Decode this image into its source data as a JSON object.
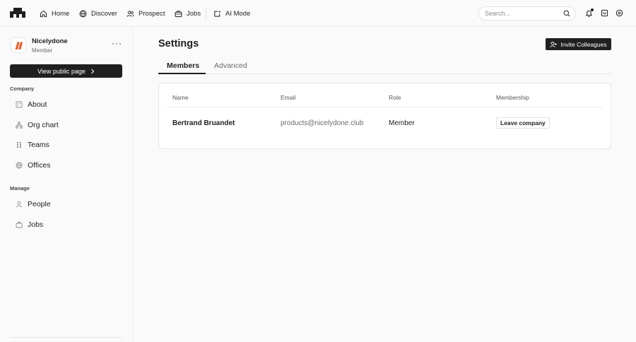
{
  "topnav": {
    "items": [
      {
        "label": "Home",
        "icon": "home-icon"
      },
      {
        "label": "Discover",
        "icon": "globe-icon"
      },
      {
        "label": "Prospect",
        "icon": "users-icon"
      },
      {
        "label": "Jobs",
        "icon": "briefcase-icon"
      },
      {
        "label": "AI Mode",
        "icon": "sparkle-icon"
      }
    ],
    "search_placeholder": "Search..."
  },
  "sidebar": {
    "org_name": "Nicelydone",
    "org_role": "Member",
    "view_public_label": "View public page",
    "company_label": "Company",
    "company_items": [
      {
        "label": "About",
        "icon": "building-icon"
      },
      {
        "label": "Org chart",
        "icon": "org-chart-icon"
      },
      {
        "label": "Teams",
        "icon": "teams-icon"
      },
      {
        "label": "Offices",
        "icon": "globe-icon"
      }
    ],
    "manage_label": "Manage",
    "manage_items": [
      {
        "label": "People",
        "icon": "person-icon"
      },
      {
        "label": "Jobs",
        "icon": "briefcase-icon"
      }
    ]
  },
  "main": {
    "title": "Settings",
    "invite_label": "Invite Colleagues",
    "tabs": [
      {
        "label": "Members",
        "active": true
      },
      {
        "label": "Advanced",
        "active": false
      }
    ],
    "table": {
      "headers": [
        "Name",
        "Email",
        "Role",
        "Membership"
      ],
      "rows": [
        {
          "name": "Bertrand Bruandet",
          "email": "products@nicelydone.club",
          "role": "Member",
          "action": "Leave company"
        }
      ]
    }
  },
  "colors": {
    "accent_dark": "#202020",
    "brand_logo_orange": "#f05a28"
  }
}
